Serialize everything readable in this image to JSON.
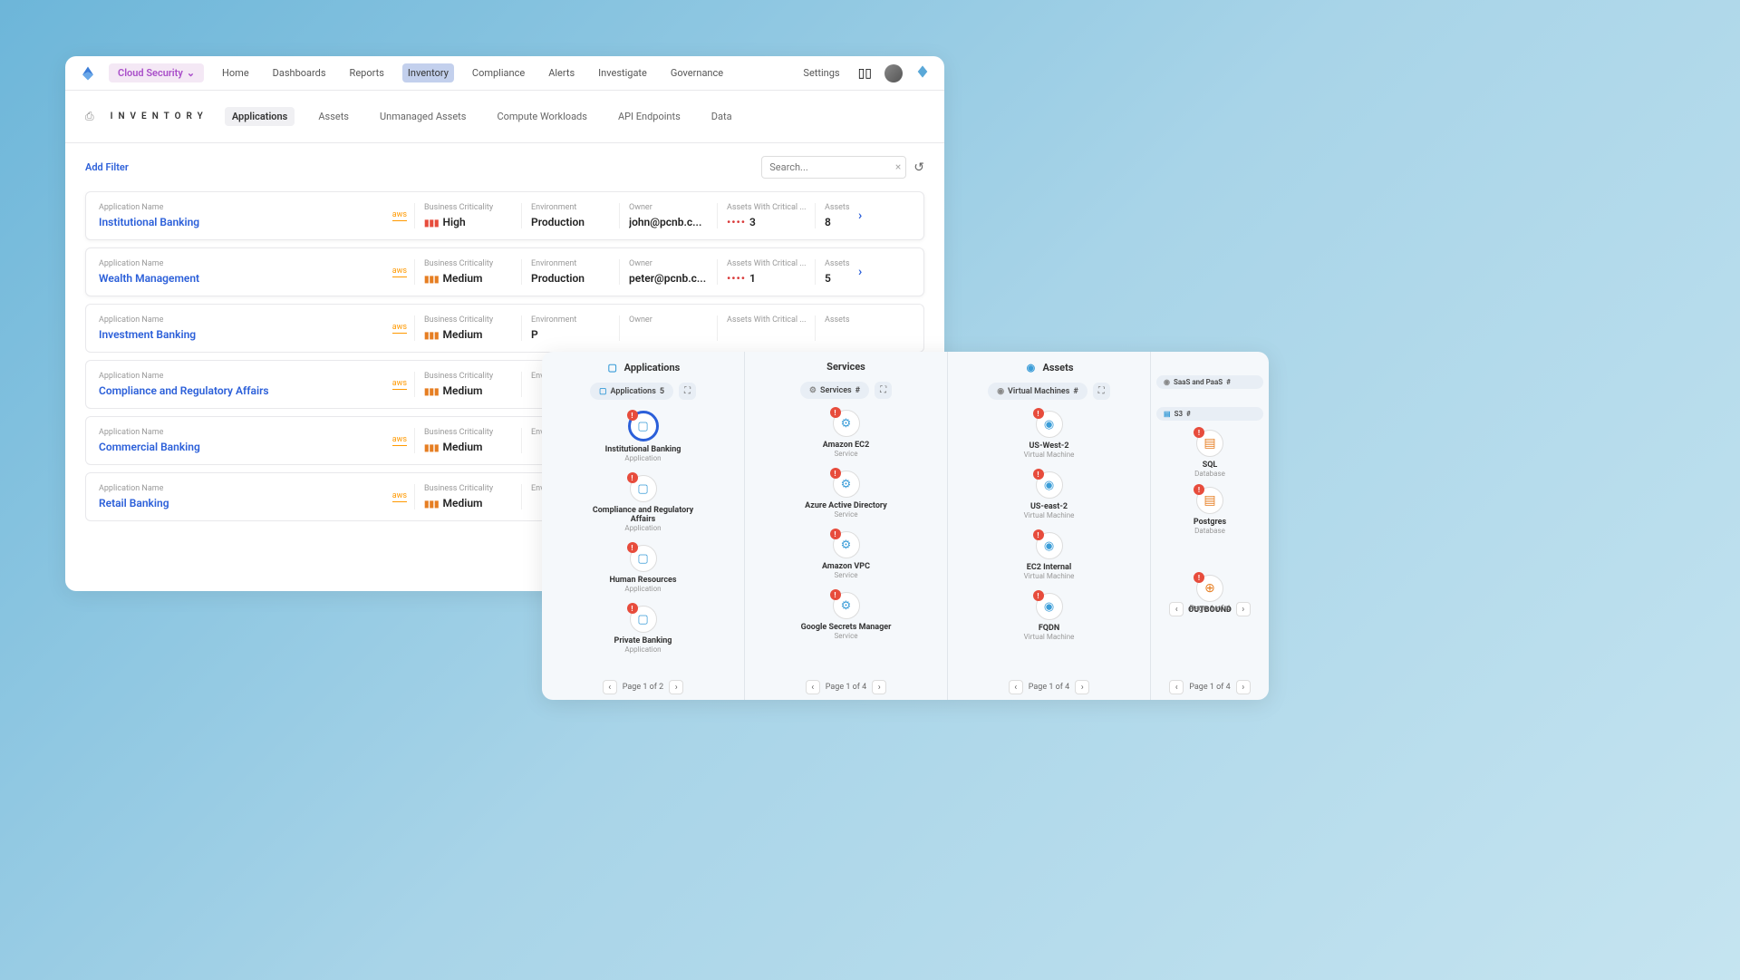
{
  "nav": {
    "cloud_security": "Cloud Security",
    "items": [
      "Home",
      "Dashboards",
      "Reports",
      "Inventory",
      "Compliance",
      "Alerts",
      "Investigate",
      "Governance"
    ],
    "settings": "Settings"
  },
  "sub": {
    "title": "INVENTORY",
    "tabs": [
      "Applications",
      "Assets",
      "Unmanaged Assets",
      "Compute Workloads",
      "API Endpoints",
      "Data"
    ]
  },
  "filters": {
    "add": "Add Filter",
    "search_placeholder": "Search..."
  },
  "cols": {
    "app_name": "Application Name",
    "crit": "Business Criticality",
    "env": "Environment",
    "owner": "Owner",
    "awcrit": "Assets With Critical ...",
    "assets": "Assets",
    "aws": "aws"
  },
  "apps": [
    {
      "name": "Institutional Banking",
      "crit": "High",
      "env": "Production",
      "owner": "john@pcnb.c...",
      "awc": "3",
      "assets": "8"
    },
    {
      "name": "Wealth Management",
      "crit": "Medium",
      "env": "Production",
      "owner": "peter@pcnb.c...",
      "awc": "1",
      "assets": "5"
    },
    {
      "name": "Investment Banking",
      "crit": "Medium",
      "env": "P",
      "owner": "",
      "awc": "",
      "assets": ""
    },
    {
      "name": "Compliance and Regulatory Affairs",
      "crit": "Medium",
      "env": "",
      "owner": "",
      "awc": "",
      "assets": ""
    },
    {
      "name": "Commercial Banking",
      "crit": "Medium",
      "env": "",
      "owner": "",
      "awc": "",
      "assets": ""
    },
    {
      "name": "Retail Banking",
      "crit": "Medium",
      "env": "",
      "owner": "",
      "awc": "",
      "assets": ""
    }
  ],
  "graph": {
    "cols": {
      "applications": "Applications",
      "services": "Services",
      "assets": "Assets"
    },
    "chips": {
      "apps": "Applications",
      "apps_count": "5",
      "svcs": "Services",
      "svcs_count": "#",
      "vms": "Virtual Machines",
      "vms_count": "#",
      "saas": "SaaS and PaaS",
      "saas_count": "#",
      "s3": "S3",
      "s3_count": "#"
    },
    "app_nodes": [
      {
        "title": "Institutional Banking",
        "sub": "Application",
        "selected": true
      },
      {
        "title": "Compliance and Regulatory Affairs",
        "sub": "Application"
      },
      {
        "title": "Human Resources",
        "sub": "Application"
      },
      {
        "title": "Private Banking",
        "sub": "Application"
      }
    ],
    "svc_nodes": [
      {
        "title": "Amazon EC2",
        "sub": "Service"
      },
      {
        "title": "Azure Active Directory",
        "sub": "Service"
      },
      {
        "title": "Amazon VPC",
        "sub": "Service"
      },
      {
        "title": "Google Secrets Manager",
        "sub": "Service"
      }
    ],
    "asset_nodes": [
      {
        "title": "US-West-2",
        "sub": "Virtual Machine"
      },
      {
        "title": "US-east-2",
        "sub": "Virtual Machine"
      },
      {
        "title": "EC2 Internal",
        "sub": "Virtual Machine"
      },
      {
        "title": "FQDN",
        "sub": "Virtual Machine"
      }
    ],
    "extra_nodes": [
      {
        "title": "SQL",
        "sub": "Database"
      },
      {
        "title": "Postgres",
        "sub": "Database"
      },
      {
        "title": "OUTBOUND",
        "sub": ""
      }
    ],
    "pagers": {
      "apps": "Page 1 of 2",
      "svcs": "Page 1 of 4",
      "assets": "Page 1 of 4",
      "extra1": "Page 1 of 4",
      "extra2": "Page 1 of 4"
    }
  }
}
